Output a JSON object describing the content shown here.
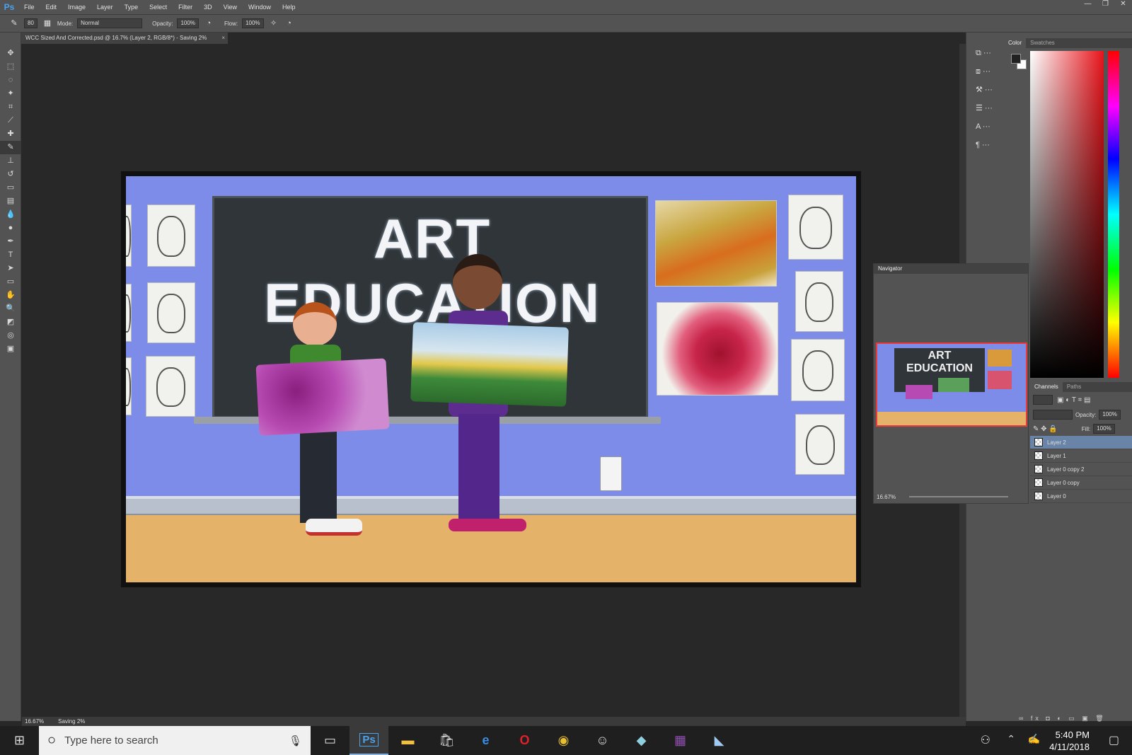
{
  "app": {
    "logo": "Ps"
  },
  "menubar": {
    "items": [
      "File",
      "Edit",
      "Image",
      "Layer",
      "Type",
      "Select",
      "Filter",
      "3D",
      "View",
      "Window",
      "Help"
    ]
  },
  "window_controls": {
    "minimize": "—",
    "restore": "❐",
    "close": "✕"
  },
  "options_bar": {
    "brush_size": "80",
    "mode_label": "Mode:",
    "mode_value": "Normal",
    "opacity_label": "Opacity:",
    "opacity_value": "100%",
    "flow_label": "Flow:",
    "flow_value": "100%"
  },
  "document_tab": {
    "title": "WCC Sized And Corrected.psd @ 16.7% (Layer 2, RGB/8*) - Saving 2%",
    "close": "×"
  },
  "canvas": {
    "title_text": "ART EDUCATION"
  },
  "status_bar": {
    "zoom": "16.67%",
    "status": "Saving 2%"
  },
  "color_panel": {
    "tabs": [
      "Color",
      "Swatches"
    ],
    "accent": "#e8141b"
  },
  "layers_panel": {
    "tabs": [
      "Channels",
      "Paths"
    ],
    "opacity_label": "Opacity:",
    "opacity_value": "100%",
    "fill_label": "Fill:",
    "fill_value": "100%",
    "layers": [
      "Layer 2",
      "Layer 1",
      "Layer 0 copy 2",
      "Layer 0 copy",
      "Layer 0"
    ],
    "selected": "Layer 2"
  },
  "navigator": {
    "title": "Navigator",
    "zoom": "16.67%",
    "thumb_title": "ART EDUCATION"
  },
  "taskbar": {
    "search_placeholder": "Type here to search",
    "time": "5:40 PM",
    "date": "4/11/2018"
  }
}
